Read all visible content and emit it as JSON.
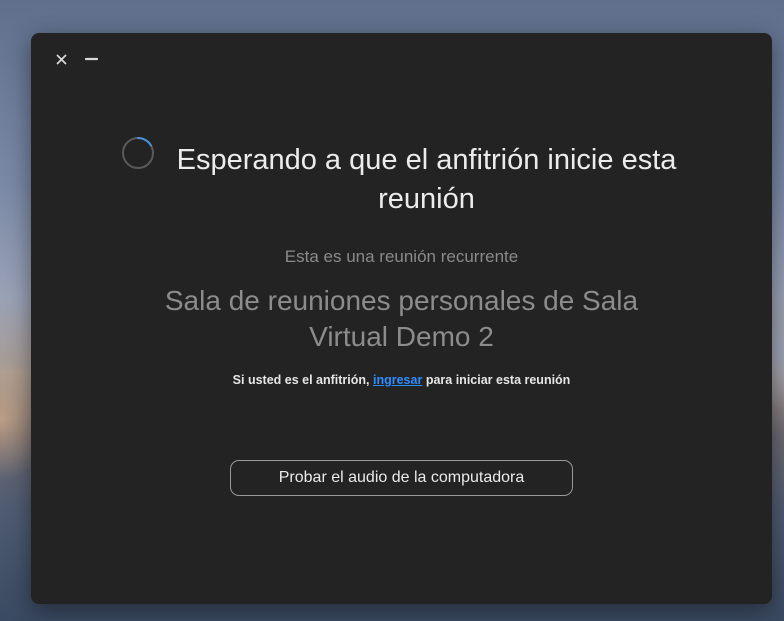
{
  "window": {
    "controls": {
      "close_icon": "close-icon",
      "minimize_icon": "minimize-icon"
    }
  },
  "main": {
    "heading": "Esperando a que el anfitrión inicie esta reunión",
    "recurring_text": "Esta es una reunión recurrente",
    "room_name": "Sala de reuniones personales de Sala Virtual Demo 2",
    "host_prefix": "Si usted es el anfitrión,",
    "host_link": "ingresar",
    "host_suffix": "para iniciar esta reunión",
    "test_audio_label": "Probar el audio de la computadora"
  },
  "colors": {
    "window_bg": "#232323",
    "link": "#2d8cff",
    "heading": "#ececec",
    "muted_text": "#8a8a8a"
  }
}
